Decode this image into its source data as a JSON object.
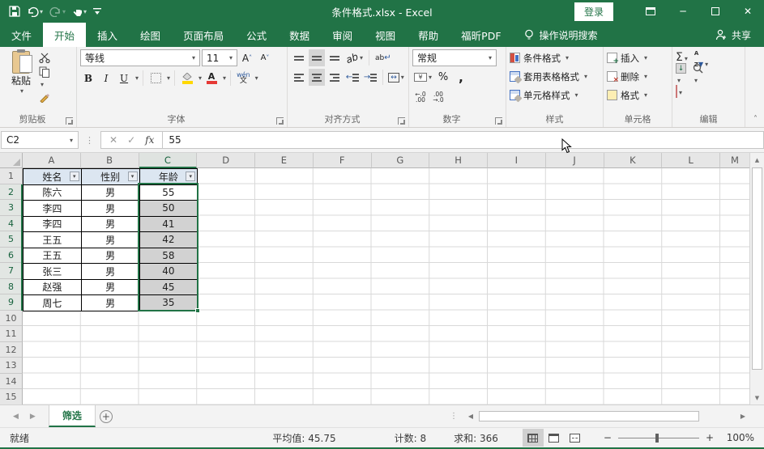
{
  "window": {
    "title": "条件格式.xlsx  -  Excel",
    "login_label": "登录"
  },
  "icons": {
    "dropdown": "▾",
    "left": "◀",
    "right": "▶",
    "up": "▲",
    "down": "▼",
    "check": "✓",
    "cancel": "✕",
    "close": "✕",
    "minimize": "─",
    "fx": "fx",
    "sigma": "Σ",
    "percent": "%",
    "comma": ",",
    "minus": "−",
    "plus": "+",
    "collapse": "˄",
    "dots": "⋮",
    "bold": "B",
    "italic": "I",
    "underline": "U",
    "letter_a": "A",
    "up_small": "˄",
    "down_small": "˅",
    "wrap_arrow": "ab",
    "orientation": "ab",
    "merge_arrow": "↔",
    "yen": "¥",
    "fill_down": "↓",
    "new_sheet": "+"
  },
  "menu": {
    "tabs": [
      {
        "label": "文件"
      },
      {
        "label": "开始",
        "active": true
      },
      {
        "label": "插入"
      },
      {
        "label": "绘图"
      },
      {
        "label": "页面布局"
      },
      {
        "label": "公式"
      },
      {
        "label": "数据"
      },
      {
        "label": "审阅"
      },
      {
        "label": "视图"
      },
      {
        "label": "帮助"
      },
      {
        "label": "福昕PDF"
      }
    ],
    "search_label": "操作说明搜索",
    "share_label": "共享"
  },
  "ribbon": {
    "clipboard": {
      "title": "剪贴板",
      "paste_label": "粘贴"
    },
    "font": {
      "title": "字体",
      "name": "等线",
      "size": "11",
      "phonetic_top": "wén",
      "phonetic_bottom": "文"
    },
    "alignment": {
      "title": "对齐方式"
    },
    "number": {
      "title": "数字",
      "format": "常规",
      "inc_top": "←.0",
      "inc_bottom": ".00",
      "dec_top": ".00",
      "dec_bottom": "→.0"
    },
    "styles": {
      "title": "样式",
      "conditional": "条件格式",
      "format_table": "套用表格格式",
      "cell_styles": "单元格样式"
    },
    "cells": {
      "title": "单元格",
      "insert": "插入",
      "delete": "删除",
      "format": "格式"
    },
    "editing": {
      "title": "编辑",
      "sort_a": "A",
      "sort_z": "Z"
    }
  },
  "formula_bar": {
    "name_box": "C2",
    "value": "55"
  },
  "grid": {
    "columns": [
      {
        "letter": "A"
      },
      {
        "letter": "B"
      },
      {
        "letter": "C"
      },
      {
        "letter": "D"
      },
      {
        "letter": "E"
      },
      {
        "letter": "F"
      },
      {
        "letter": "G"
      },
      {
        "letter": "H"
      },
      {
        "letter": "I"
      },
      {
        "letter": "J"
      },
      {
        "letter": "K"
      },
      {
        "letter": "L"
      },
      {
        "letter": "M",
        "partial": true
      }
    ],
    "selected_column": "C",
    "rows_visible": 15,
    "selected_row_start": 2,
    "selected_row_end": 9,
    "table": {
      "headers": [
        "姓名",
        "性别",
        "年龄"
      ],
      "rows": [
        [
          "陈六",
          "男",
          "55"
        ],
        [
          "李四",
          "男",
          "50"
        ],
        [
          "李四",
          "男",
          "41"
        ],
        [
          "王五",
          "男",
          "42"
        ],
        [
          "王五",
          "男",
          "58"
        ],
        [
          "张三",
          "男",
          "40"
        ],
        [
          "赵强",
          "男",
          "45"
        ],
        [
          "周七",
          "男",
          "35"
        ]
      ]
    }
  },
  "sheet_bar": {
    "tabs": [
      {
        "label": "筛选",
        "active": true
      }
    ]
  },
  "status_bar": {
    "mode": "就绪",
    "average": "平均值: 45.75",
    "count": "计数: 8",
    "sum": "求和: 366",
    "zoom": "100%"
  },
  "colors": {
    "accent": "#217346",
    "table_header_fill": "#DCE6F1",
    "selection_fill": "#D2D2D2",
    "fill_color_swatch": "#FFD800",
    "font_color_swatch": "#E53935"
  }
}
